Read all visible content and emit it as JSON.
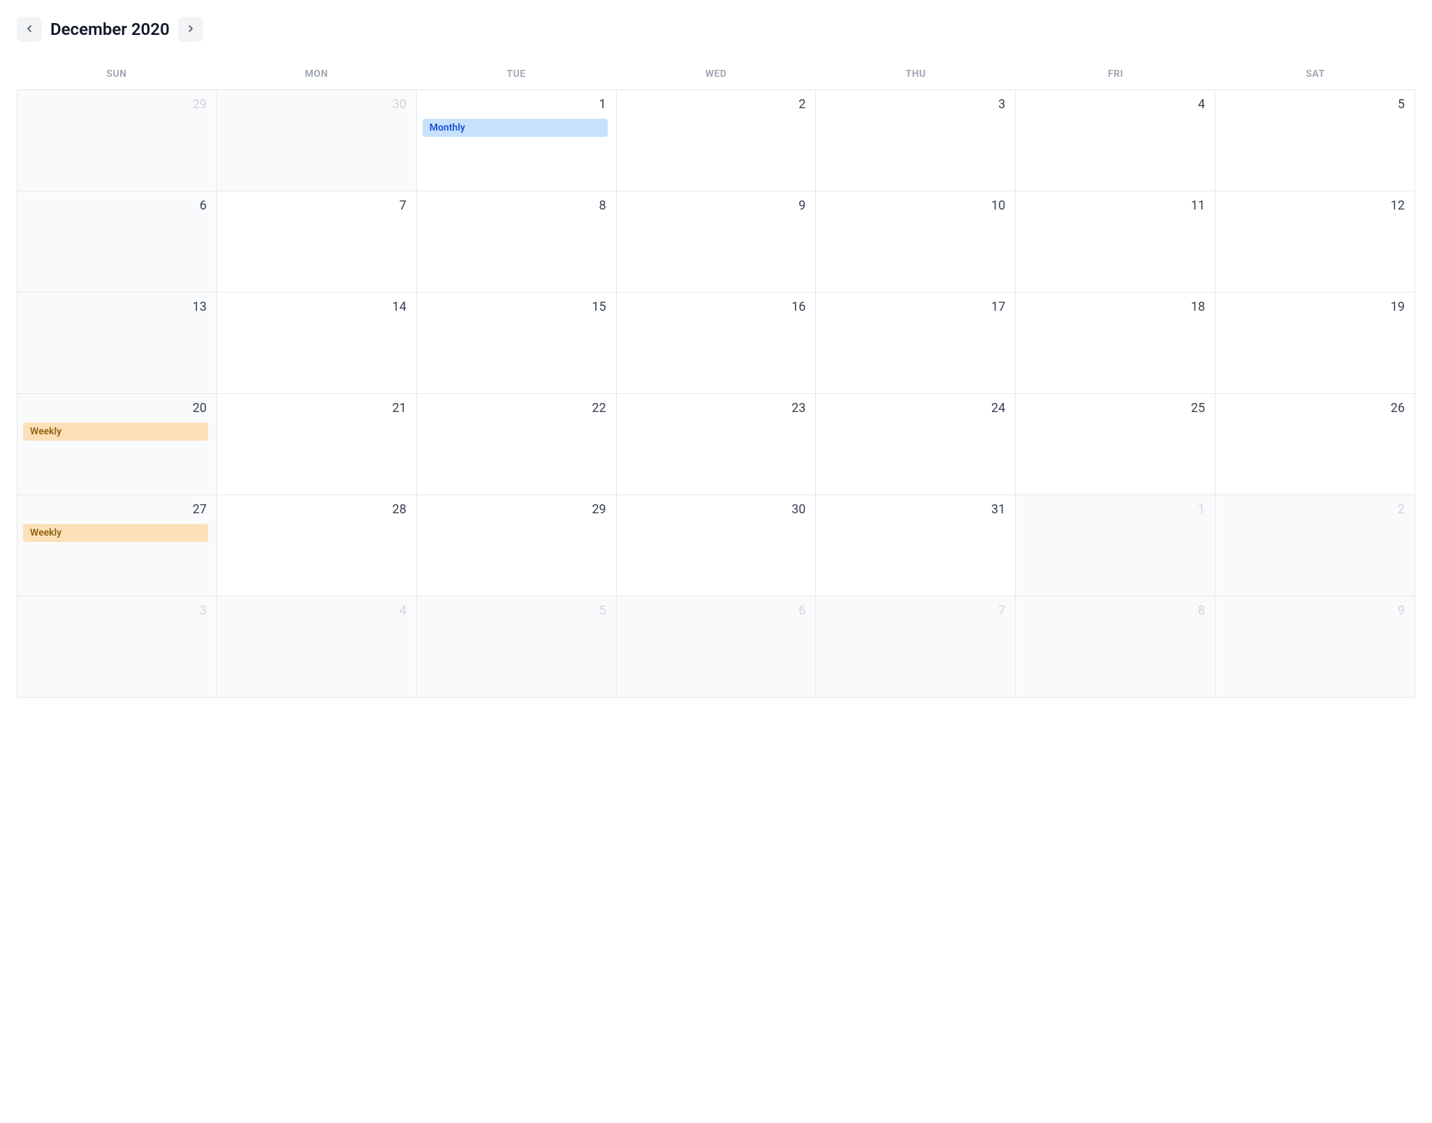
{
  "header": {
    "title": "December 2020"
  },
  "weekdays": [
    "SUN",
    "MON",
    "TUE",
    "WED",
    "THU",
    "FRI",
    "SAT"
  ],
  "cells": [
    {
      "num": "29",
      "outside": true
    },
    {
      "num": "30",
      "outside": true
    },
    {
      "num": "1",
      "events": [
        {
          "label": "Monthly",
          "color": "blue"
        }
      ]
    },
    {
      "num": "2"
    },
    {
      "num": "3"
    },
    {
      "num": "4"
    },
    {
      "num": "5"
    },
    {
      "num": "6"
    },
    {
      "num": "7"
    },
    {
      "num": "8"
    },
    {
      "num": "9"
    },
    {
      "num": "10"
    },
    {
      "num": "11"
    },
    {
      "num": "12"
    },
    {
      "num": "13"
    },
    {
      "num": "14"
    },
    {
      "num": "15"
    },
    {
      "num": "16"
    },
    {
      "num": "17"
    },
    {
      "num": "18"
    },
    {
      "num": "19"
    },
    {
      "num": "20",
      "events": [
        {
          "label": "Weekly",
          "color": "orange"
        }
      ]
    },
    {
      "num": "21"
    },
    {
      "num": "22"
    },
    {
      "num": "23"
    },
    {
      "num": "24"
    },
    {
      "num": "25"
    },
    {
      "num": "26"
    },
    {
      "num": "27",
      "events": [
        {
          "label": "Weekly",
          "color": "orange"
        }
      ]
    },
    {
      "num": "28"
    },
    {
      "num": "29"
    },
    {
      "num": "30"
    },
    {
      "num": "31"
    },
    {
      "num": "1",
      "outside": true
    },
    {
      "num": "2",
      "outside": true
    },
    {
      "num": "3",
      "outside": true
    },
    {
      "num": "4",
      "outside": true
    },
    {
      "num": "5",
      "outside": true
    },
    {
      "num": "6",
      "outside": true
    },
    {
      "num": "7",
      "outside": true
    },
    {
      "num": "8",
      "outside": true
    },
    {
      "num": "9",
      "outside": true
    }
  ]
}
